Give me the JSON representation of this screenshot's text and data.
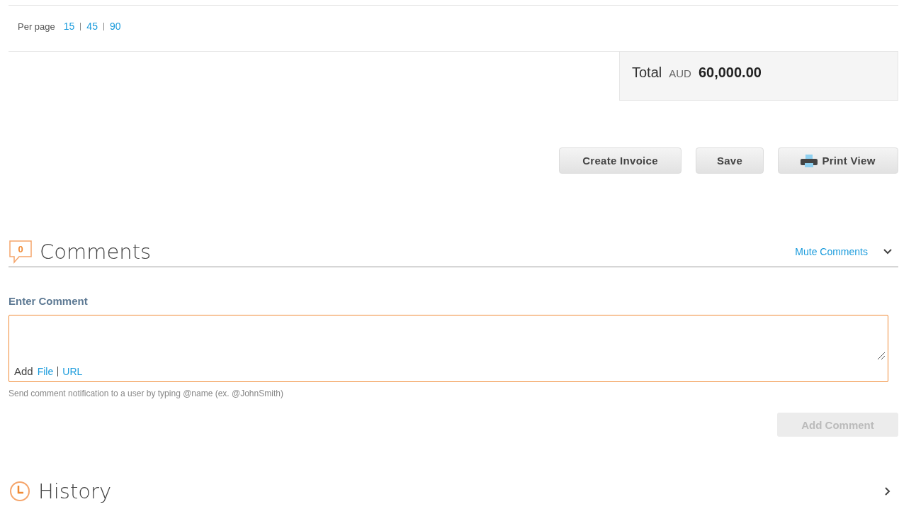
{
  "pagination": {
    "label": "Per page",
    "options": [
      "15",
      "45",
      "90"
    ]
  },
  "total": {
    "label": "Total",
    "currency": "AUD",
    "amount": "60,000.00"
  },
  "actions": [
    {
      "label": "Create Invoice",
      "kind": "plain"
    },
    {
      "label": "Save",
      "kind": "plain"
    },
    {
      "label": "Print View",
      "kind": "print"
    }
  ],
  "comments": {
    "count": "0",
    "title": "Comments",
    "mute_link": "Mute Comments",
    "expanded": true,
    "field_label": "Enter Comment",
    "attach_label": "Add",
    "attach_links": [
      "File",
      "URL"
    ],
    "hint": "Send comment notification to a user by typing @name (ex. @JohnSmith)",
    "submit": {
      "label": "Add Comment",
      "disabled": true
    }
  },
  "history": {
    "title": "History",
    "expanded": false
  }
}
